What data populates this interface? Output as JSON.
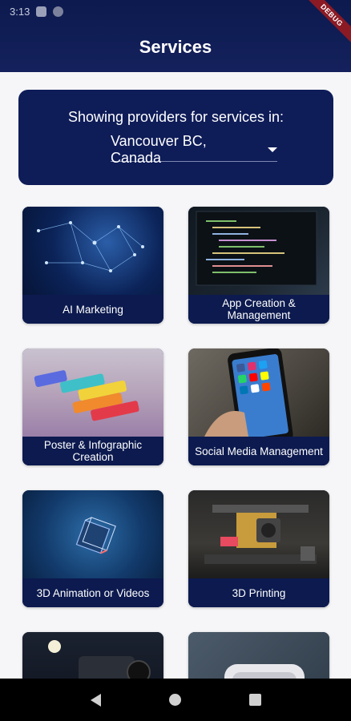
{
  "status_bar": {
    "time": "3:13"
  },
  "debug_banner": "DEBUG",
  "header": {
    "title": "Services"
  },
  "location": {
    "caption": "Showing providers for services in:",
    "selected": "Vancouver BC, Canada"
  },
  "services": [
    {
      "label": "AI Marketing",
      "image": "network-brain-photo"
    },
    {
      "label": "App Creation & Management",
      "image": "code-screen-photo"
    },
    {
      "label": "Poster & Infographic Creation",
      "image": "chalk-pastels-photo"
    },
    {
      "label": "Social Media Management",
      "image": "smartphone-apps-photo"
    },
    {
      "label": "3D Animation or Videos",
      "image": "glass-cube-photo"
    },
    {
      "label": "3D Printing",
      "image": "3d-printer-photo"
    },
    {
      "label": "",
      "image": "video-camera-photo"
    },
    {
      "label": "",
      "image": "vr-headset-photo"
    }
  ],
  "colors": {
    "primary_navy": "#0c1a4f",
    "background": "#f6f6f8",
    "debug_red": "#8b1a24"
  }
}
